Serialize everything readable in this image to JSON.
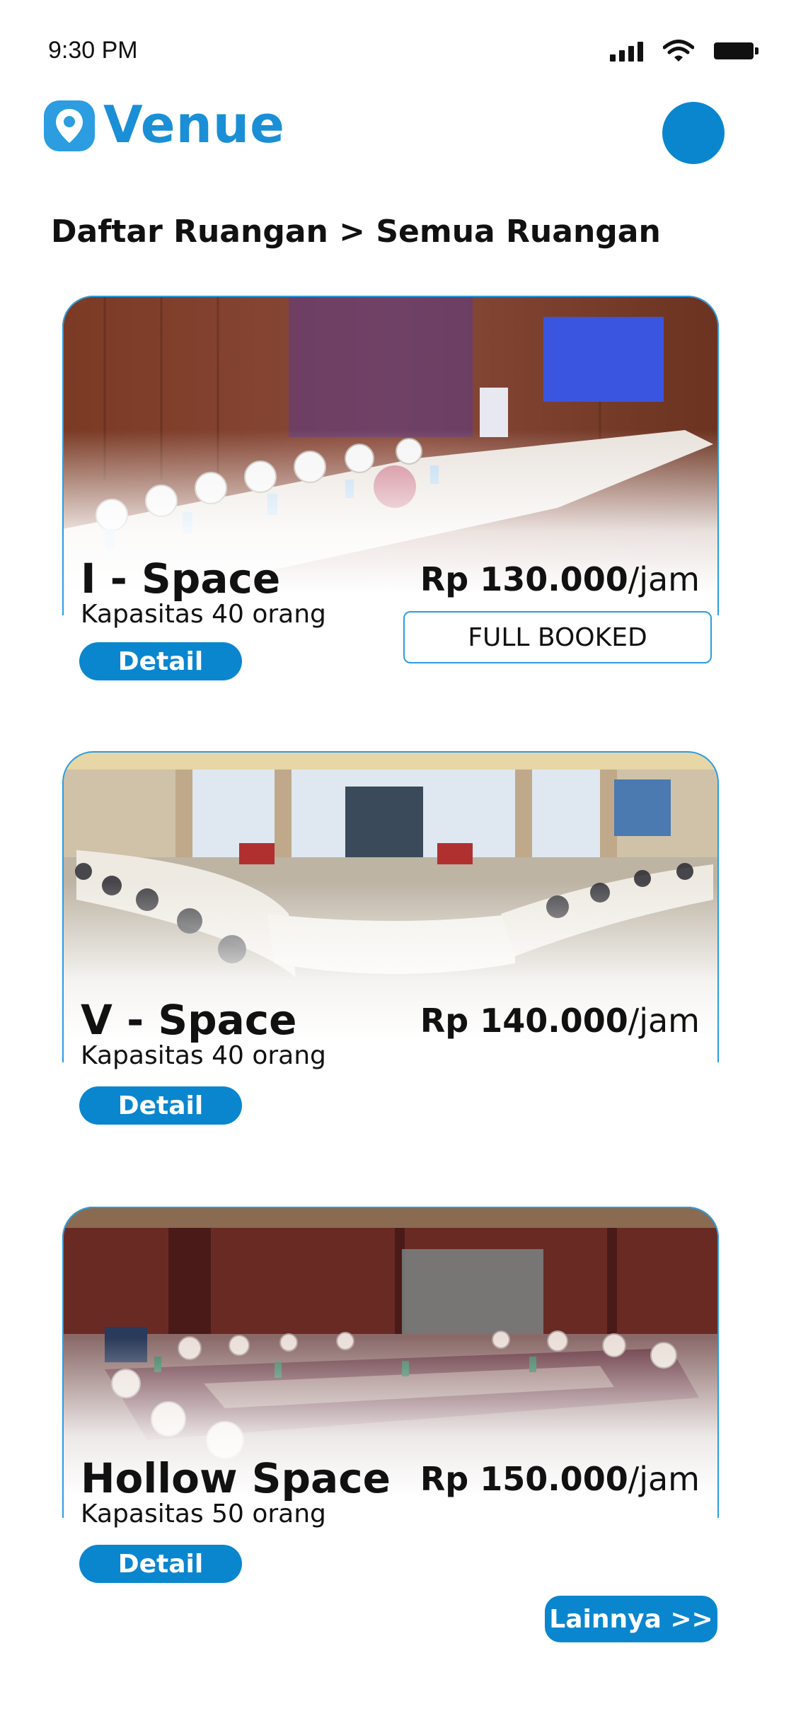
{
  "status_bar": {
    "time": "9:30 PM",
    "icons": [
      "signal-icon",
      "wifi-icon",
      "battery-icon"
    ]
  },
  "header": {
    "app_name": "Venue",
    "logo_icon": "location-pin-icon",
    "accent_color": "#0a86cf"
  },
  "breadcrumb": "Daftar Ruangan > Semua Ruangan",
  "rooms": [
    {
      "name": "I - Space",
      "capacity": "Kapasitas 40 orang",
      "price": "Rp 130.000",
      "unit": "/jam",
      "detail_label": "Detail",
      "status": "FULL BOOKED"
    },
    {
      "name": "V - Space",
      "capacity": "Kapasitas 40 orang",
      "price": "Rp 140.000",
      "unit": "/jam",
      "detail_label": "Detail"
    },
    {
      "name": "Hollow Space",
      "capacity": "Kapasitas 50 orang",
      "price": "Rp 150.000",
      "unit": "/jam",
      "detail_label": "Detail"
    }
  ],
  "more_label": "Lainnya >>"
}
